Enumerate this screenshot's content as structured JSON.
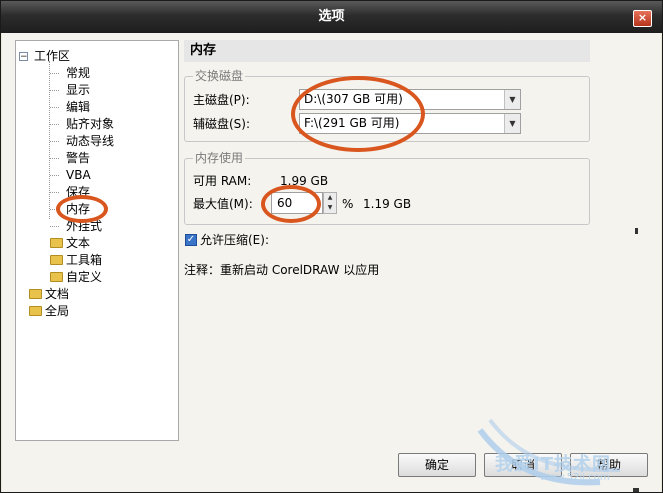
{
  "window": {
    "title": "选项",
    "close_glyph": "×"
  },
  "tree": {
    "root_workspace": "工作区",
    "children": [
      "常规",
      "显示",
      "编辑",
      "贴齐对象",
      "动态导线",
      "警告",
      "VBA",
      "保存",
      "内存",
      "外挂式"
    ],
    "collapsed_children": [
      "文本",
      "工具箱",
      "自定义"
    ],
    "others": [
      "文档",
      "全局"
    ],
    "selected": "内存",
    "expanded_glyph": "−",
    "collapsed_glyph": "+"
  },
  "panel": {
    "title": "内存",
    "swap_group": {
      "label": "交换磁盘",
      "primary_label": "主磁盘(P):",
      "primary_value": "D:\\(307 GB 可用)",
      "secondary_label": "辅磁盘(S):",
      "secondary_value": "F:\\(291 GB 可用)"
    },
    "memory_group": {
      "label": "内存使用",
      "ram_label": "可用 RAM:",
      "ram_value": "1.99 GB",
      "max_label": "最大值(M):",
      "max_value": "60",
      "percent_unit": "%",
      "max_result": "1.19 GB"
    },
    "compress": {
      "label": "允许压缩(E):",
      "checked": true
    },
    "note": "注释：重新启动 CorelDRAW 以应用"
  },
  "buttons": {
    "ok": "确定",
    "cancel": "取消",
    "help": "帮助"
  },
  "watermark": {
    "text": "我爱IT技术网",
    "url": "www.52ij.com"
  },
  "colors": {
    "highlight_circle": "#d9561e",
    "titlebar": "#2c2c2c"
  }
}
